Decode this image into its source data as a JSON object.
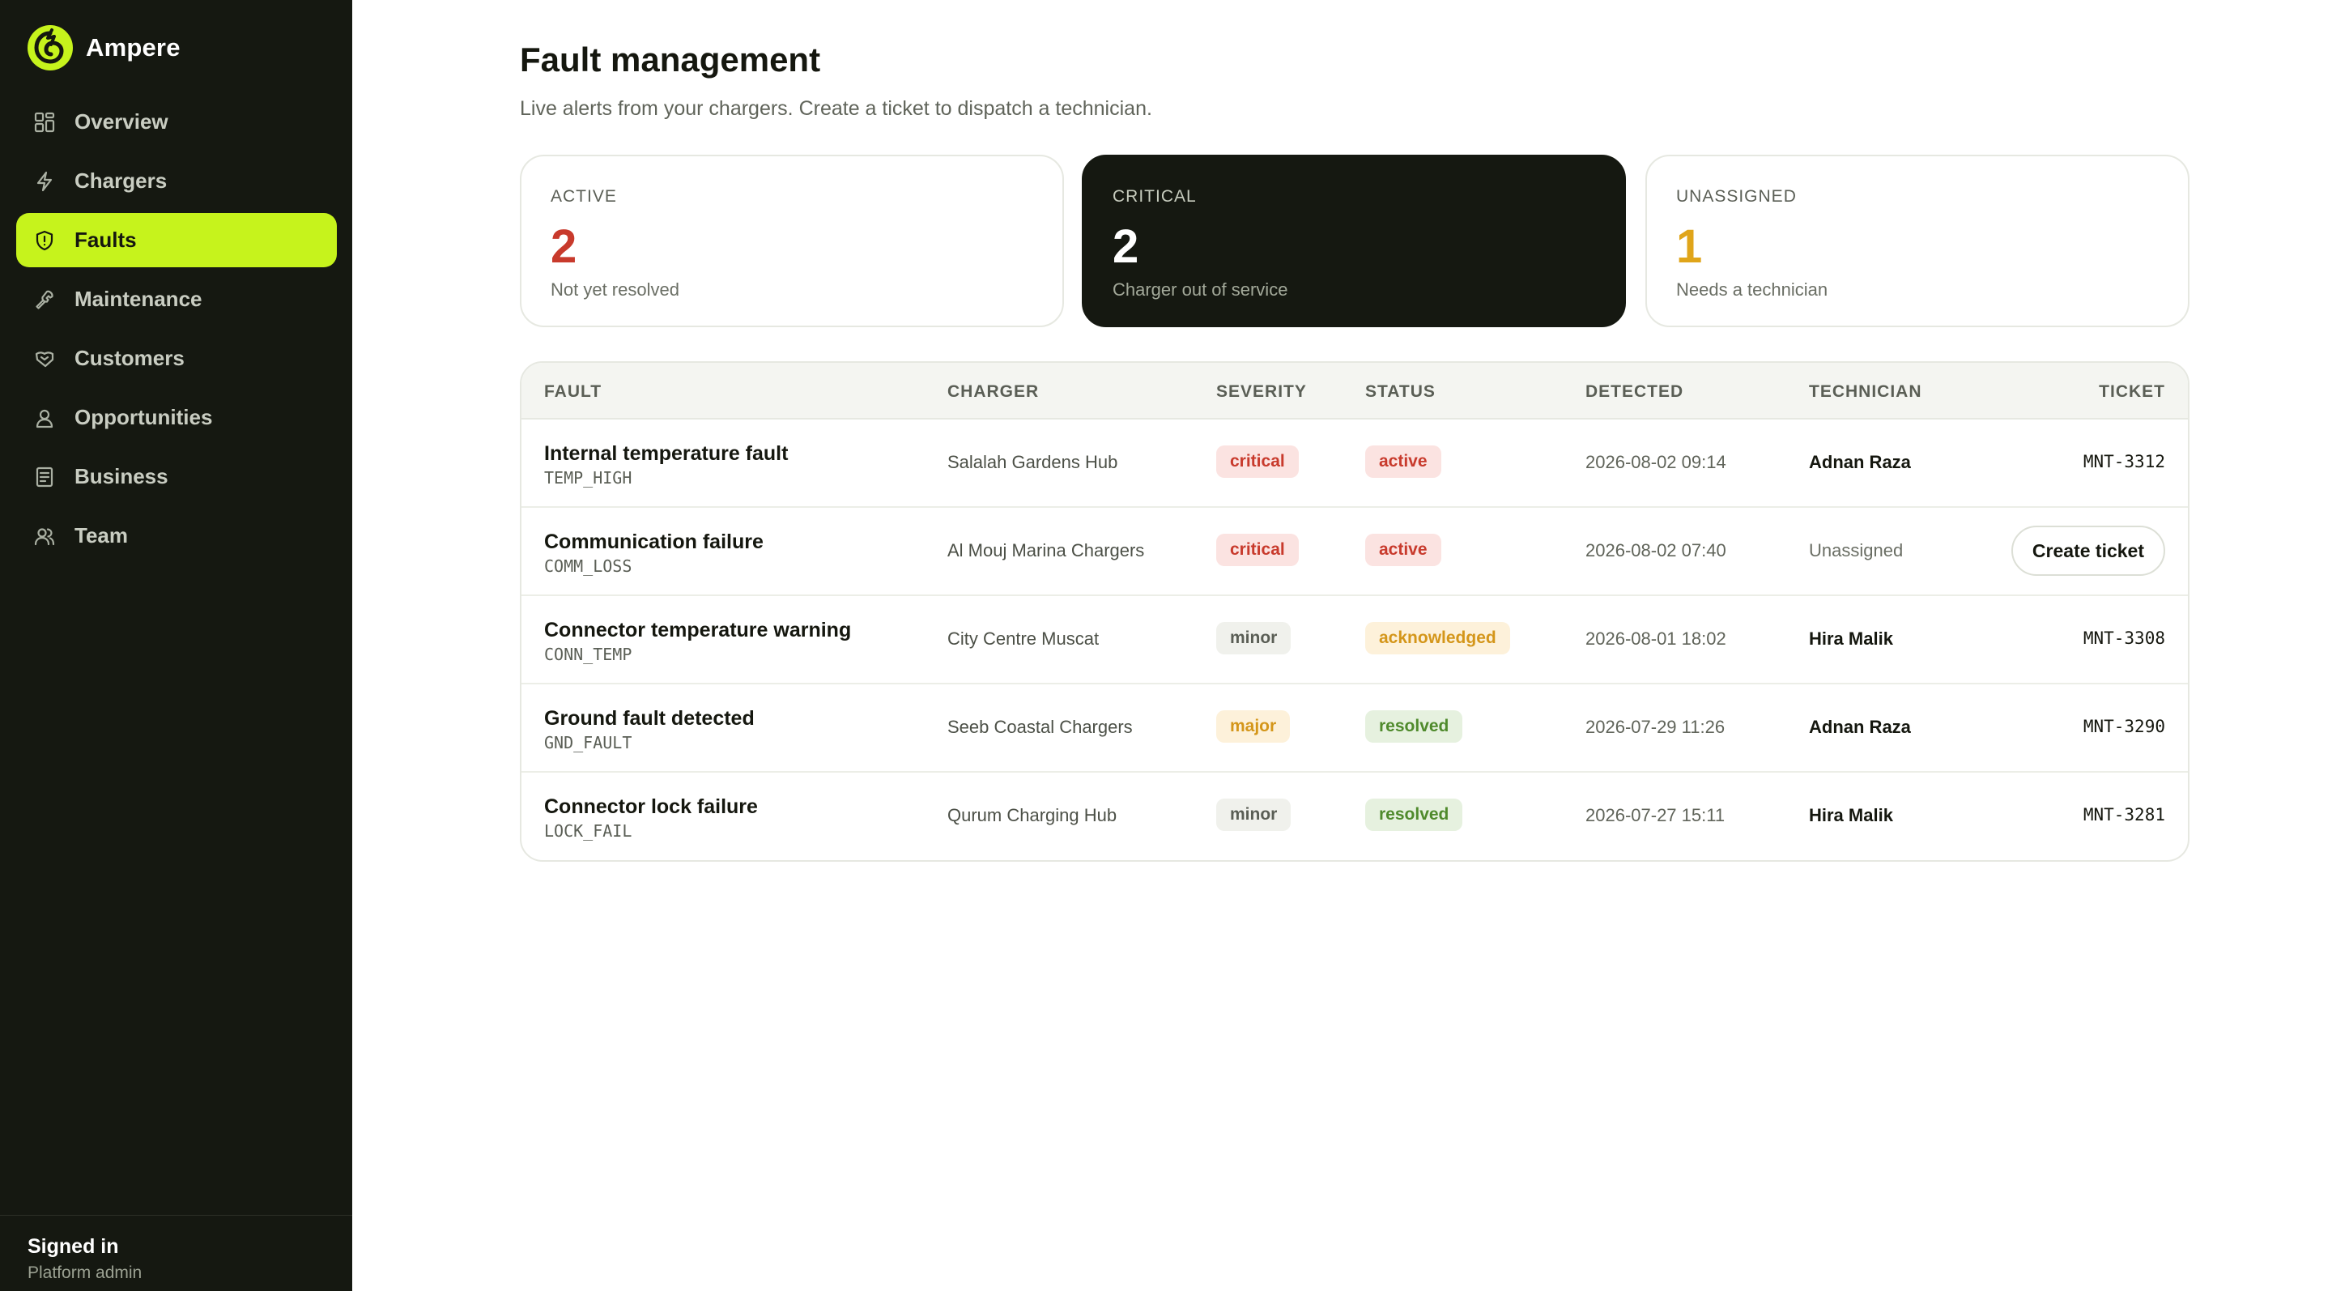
{
  "app": {
    "name": "Ampere"
  },
  "sidebar": {
    "items": [
      {
        "label": "Overview",
        "icon": "grid-icon",
        "active": false
      },
      {
        "label": "Chargers",
        "icon": "bolt-icon",
        "active": false
      },
      {
        "label": "Faults",
        "icon": "shield-alert-icon",
        "active": true
      },
      {
        "label": "Maintenance",
        "icon": "wrench-icon",
        "active": false
      },
      {
        "label": "Customers",
        "icon": "handshake-icon",
        "active": false
      },
      {
        "label": "Opportunities",
        "icon": "user-badge-icon",
        "active": false
      },
      {
        "label": "Business",
        "icon": "document-icon",
        "active": false
      },
      {
        "label": "Team",
        "icon": "users-icon",
        "active": false
      }
    ],
    "signin": {
      "title": "Signed in",
      "role": "Platform admin"
    }
  },
  "page": {
    "title": "Fault management",
    "subtitle": "Live alerts from your chargers. Create a ticket to dispatch a technician."
  },
  "stats": [
    {
      "key": "ACTIVE",
      "value": "2",
      "desc": "Not yet resolved",
      "color": "#c83a2c"
    },
    {
      "key": "CRITICAL",
      "value": "2",
      "desc": "Charger out of service",
      "color": "#ffffff"
    },
    {
      "key": "UNASSIGNED",
      "value": "1",
      "desc": "Needs a technician",
      "color": "#e0a51a"
    }
  ],
  "table": {
    "headers": {
      "fault": "FAULT",
      "charger": "CHARGER",
      "severity": "SEVERITY",
      "status": "STATUS",
      "detected": "DETECTED",
      "technician": "TECHNICIAN",
      "ticket": "TICKET"
    },
    "rows": [
      {
        "fault": "Internal temperature fault",
        "code": "TEMP_HIGH",
        "charger": "Salalah Gardens Hub",
        "severity": "critical",
        "status": "active",
        "detected": "2026-08-02 09:14",
        "technician": "Adnan Raza",
        "ticket": "MNT-3312"
      },
      {
        "fault": "Communication failure",
        "code": "COMM_LOSS",
        "charger": "Al Mouj Marina Chargers",
        "severity": "critical",
        "status": "active",
        "detected": "2026-08-02 07:40",
        "technician": "Unassigned",
        "action": "Create ticket"
      },
      {
        "fault": "Connector temperature warning",
        "code": "CONN_TEMP",
        "charger": "City Centre Muscat",
        "severity": "minor",
        "status": "acknowledged",
        "detected": "2026-08-01 18:02",
        "technician": "Hira Malik",
        "ticket": "MNT-3308"
      },
      {
        "fault": "Ground fault detected",
        "code": "GND_FAULT",
        "charger": "Seeb Coastal Chargers",
        "severity": "major",
        "status": "resolved",
        "detected": "2026-07-29 11:26",
        "technician": "Adnan Raza",
        "ticket": "MNT-3290"
      },
      {
        "fault": "Connector lock failure",
        "code": "LOCK_FAIL",
        "charger": "Qurum Charging Hub",
        "severity": "minor",
        "status": "resolved",
        "detected": "2026-07-27 15:11",
        "technician": "Hira Malik",
        "ticket": "MNT-3281"
      }
    ]
  },
  "colors": {
    "accent": "#c6f31c",
    "sidebar_bg": "#151811",
    "critical_bg": "#fbe3e1",
    "critical_fg": "#c83a2c",
    "minor_bg": "#f0f1ec",
    "minor_fg": "#5a5e55",
    "major_bg": "#fdf1da",
    "major_fg": "#d4961a",
    "acknowledged_bg": "#fdf1da",
    "acknowledged_fg": "#d4961a",
    "resolved_bg": "#e6f1df",
    "resolved_fg": "#4f8a2c"
  }
}
